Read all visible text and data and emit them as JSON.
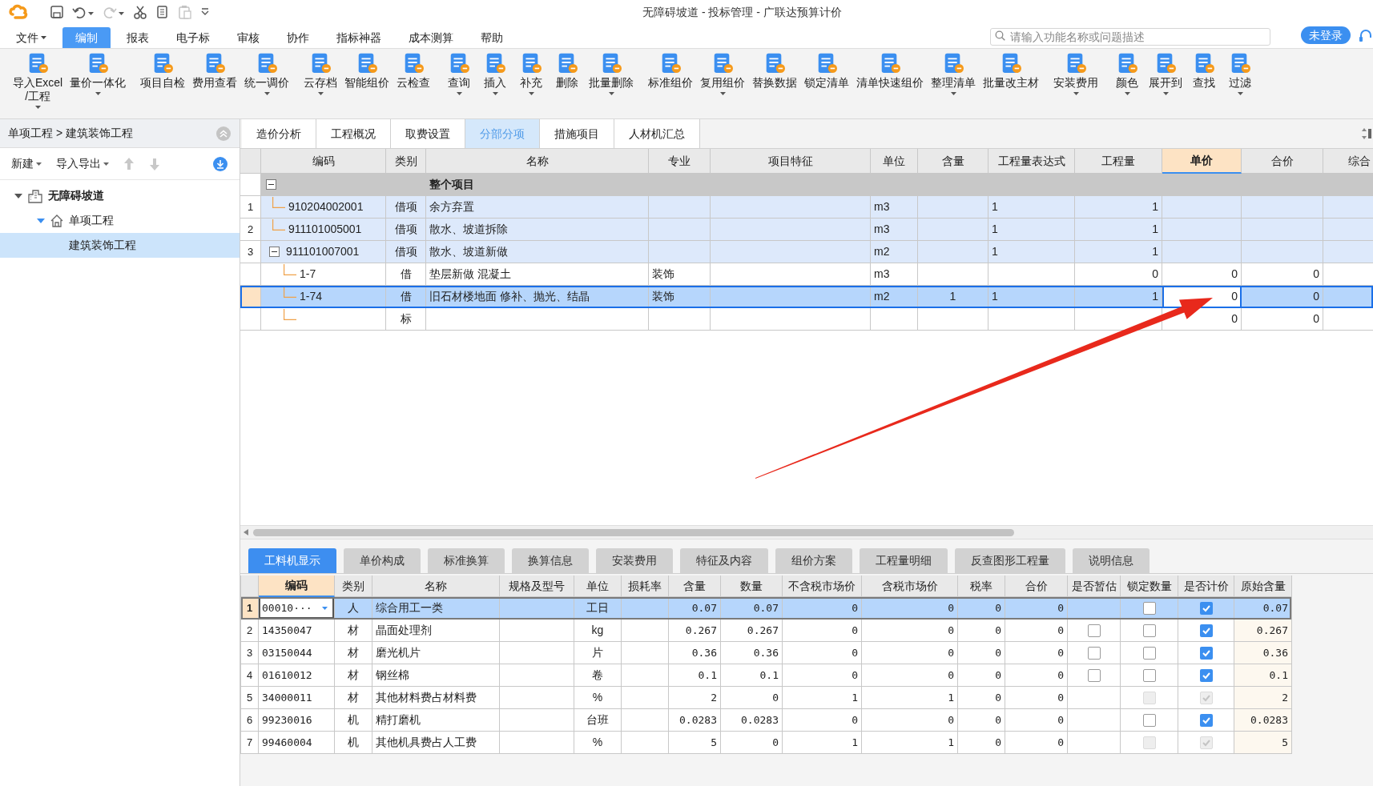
{
  "window": {
    "title": "无障碍坡道 - 投标管理 - 广联达预算计价"
  },
  "quick_access": [
    {
      "kind": "save",
      "disabled": false
    },
    {
      "kind": "undo",
      "disabled": false
    },
    {
      "kind": "redo",
      "disabled": true
    },
    {
      "kind": "cut",
      "disabled": false
    },
    {
      "kind": "copy",
      "disabled": false
    },
    {
      "kind": "paste",
      "disabled": true
    },
    {
      "kind": "customize",
      "disabled": false
    }
  ],
  "menu": [
    {
      "label": "文件",
      "dropdown": true,
      "selected": false
    },
    {
      "label": "编制",
      "dropdown": false,
      "selected": true
    },
    {
      "label": "报表",
      "dropdown": false,
      "selected": false
    },
    {
      "label": "电子标",
      "dropdown": false,
      "selected": false
    },
    {
      "label": "审核",
      "dropdown": false,
      "selected": false
    },
    {
      "label": "协作",
      "dropdown": false,
      "selected": false
    },
    {
      "label": "指标神器",
      "dropdown": false,
      "selected": false
    },
    {
      "label": "成本测算",
      "dropdown": false,
      "selected": false
    },
    {
      "label": "帮助",
      "dropdown": false,
      "selected": false
    }
  ],
  "search": {
    "placeholder": "请输入功能名称或问题描述"
  },
  "login_button": "未登录",
  "ribbon": {
    "groups": [
      [
        {
          "label": "导入Excel\n/工程",
          "dropdown": true
        },
        {
          "label": "量价一体化",
          "dropdown": true
        }
      ],
      [
        {
          "label": "项目自检",
          "dropdown": false
        },
        {
          "label": "费用查看",
          "dropdown": false
        },
        {
          "label": "统一调价",
          "dropdown": true
        }
      ],
      [
        {
          "label": "云存档",
          "dropdown": true
        },
        {
          "label": "智能组价",
          "dropdown": false
        },
        {
          "label": "云检查",
          "dropdown": false
        }
      ],
      [
        {
          "label": "查询",
          "dropdown": true
        },
        {
          "label": "插入",
          "dropdown": true
        },
        {
          "label": "补充",
          "dropdown": true
        },
        {
          "label": "删除",
          "dropdown": false
        },
        {
          "label": "批量删除",
          "dropdown": true
        }
      ],
      [
        {
          "label": "标准组价",
          "dropdown": false
        },
        {
          "label": "复用组价",
          "dropdown": true
        },
        {
          "label": "替换数据",
          "dropdown": false
        },
        {
          "label": "锁定清单",
          "dropdown": false
        },
        {
          "label": "清单快速组价",
          "dropdown": false
        },
        {
          "label": "整理清单",
          "dropdown": true
        },
        {
          "label": "批量改主材",
          "dropdown": false
        }
      ],
      [
        {
          "label": "安装费用",
          "dropdown": true
        }
      ],
      [
        {
          "label": "颜色",
          "dropdown": true
        },
        {
          "label": "展开到",
          "dropdown": true
        },
        {
          "label": "查找",
          "dropdown": false
        },
        {
          "label": "过滤",
          "dropdown": true
        }
      ]
    ]
  },
  "breadcrumb": "单项工程 > 建筑装饰工程",
  "left_toolbar": {
    "buttons": [
      {
        "label": "新建",
        "dropdown": true
      },
      {
        "label": "导入导出",
        "dropdown": true
      }
    ],
    "arrows": [
      {
        "kind": "up",
        "disabled": true
      },
      {
        "kind": "down",
        "disabled": true
      }
    ]
  },
  "project_tree": [
    {
      "label": "无障碍坡道",
      "kind": "project",
      "expanded": true,
      "selected": false,
      "children": [
        {
          "label": "单项工程",
          "kind": "single",
          "expanded": true,
          "selected": false,
          "children": [
            {
              "label": "建筑装饰工程",
              "selected": true
            }
          ]
        }
      ]
    }
  ],
  "tabs": [
    {
      "label": "造价分析",
      "selected": false
    },
    {
      "label": "工程概况",
      "selected": false
    },
    {
      "label": "取费设置",
      "selected": false
    },
    {
      "label": "分部分项",
      "selected": true
    },
    {
      "label": "措施项目",
      "selected": false
    },
    {
      "label": "人材机汇总",
      "selected": false
    }
  ],
  "table": {
    "columns": [
      {
        "label": "编码",
        "selected": false
      },
      {
        "label": "类别",
        "selected": false
      },
      {
        "label": "名称",
        "selected": false
      },
      {
        "label": "专业",
        "selected": false
      },
      {
        "label": "项目特征",
        "selected": false
      },
      {
        "label": "单位",
        "selected": false
      },
      {
        "label": "含量",
        "selected": false
      },
      {
        "label": "工程量表达式",
        "selected": false
      },
      {
        "label": "工程量",
        "selected": false
      },
      {
        "label": "单价",
        "selected": true
      },
      {
        "label": "合价",
        "selected": false
      },
      {
        "label": "综合",
        "selected": false
      }
    ],
    "rows": [
      {
        "kind": "section",
        "name": "整个项目",
        "expanded": true,
        "selected": false,
        "children": [
          {
            "kind": "bill",
            "number": "1",
            "code": "910204002001",
            "category": "借项",
            "name": "余方弃置",
            "unit": "m3",
            "expression": "1",
            "quantity": "1",
            "selected": false
          },
          {
            "kind": "bill",
            "number": "2",
            "code": "911101005001",
            "category": "借项",
            "name": "散水、坡道拆除",
            "unit": "m3",
            "expression": "1",
            "quantity": "1",
            "selected": false
          },
          {
            "kind": "bill",
            "number": "3",
            "code": "911101007001",
            "category": "借项",
            "name": "散水、坡道新做",
            "unit": "m2",
            "expression": "1",
            "quantity": "1",
            "selected": false,
            "expanded": true,
            "children": [
              {
                "kind": "quota",
                "code": "1-7",
                "category": "借",
                "name": "垫层新做 混凝土",
                "specialty": "装饰",
                "unit": "m3",
                "quantity": "0",
                "unit_price": "0",
                "total": "0",
                "selected": false
              },
              {
                "kind": "quota",
                "code": "1-74",
                "category": "借",
                "name": "旧石材楼地面 修补、抛光、结晶",
                "specialty": "装饰",
                "unit": "m2",
                "content": "1",
                "expression": "1",
                "quantity": "1",
                "unit_price": "0",
                "total": "0",
                "selected": true
              },
              {
                "kind": "quota",
                "category": "标",
                "unit_price": "0",
                "total": "0",
                "selected": false
              }
            ]
          }
        ]
      }
    ]
  },
  "bottom_tabs": [
    {
      "label": "工料机显示",
      "selected": true
    },
    {
      "label": "单价构成",
      "selected": false
    },
    {
      "label": "标准换算",
      "selected": false
    },
    {
      "label": "换算信息",
      "selected": false
    },
    {
      "label": "安装费用",
      "selected": false
    },
    {
      "label": "特征及内容",
      "selected": false
    },
    {
      "label": "组价方案",
      "selected": false
    },
    {
      "label": "工程量明细",
      "selected": false
    },
    {
      "label": "反查图形工程量",
      "selected": false
    },
    {
      "label": "说明信息",
      "selected": false
    }
  ],
  "resource_table": {
    "columns": [
      {
        "label": "编码",
        "selected": true
      },
      {
        "label": "类别",
        "selected": false
      },
      {
        "label": "名称",
        "selected": false
      },
      {
        "label": "规格及型号",
        "selected": false
      },
      {
        "label": "单位",
        "selected": false
      },
      {
        "label": "损耗率",
        "selected": false
      },
      {
        "label": "含量",
        "selected": false
      },
      {
        "label": "数量",
        "selected": false
      },
      {
        "label": "不含税市场价",
        "selected": false
      },
      {
        "label": "含税市场价",
        "selected": false
      },
      {
        "label": "税率",
        "selected": false
      },
      {
        "label": "合价",
        "selected": false
      },
      {
        "label": "是否暂估",
        "selected": false
      },
      {
        "label": "锁定数量",
        "selected": false
      },
      {
        "label": "是否计价",
        "selected": false
      },
      {
        "label": "原始含量",
        "selected": false
      }
    ],
    "rows": [
      {
        "number": "1",
        "code": "00010···",
        "category": "人",
        "name": "综合用工一类",
        "unit": "工日",
        "content": "0.07",
        "quantity": "0.07",
        "price_excl_tax": "0",
        "price_incl_tax": "0",
        "tax_rate": "0",
        "total": "0",
        "lock_quantity": {
          "checked": false,
          "disabled": false
        },
        "priced": {
          "checked": true,
          "disabled": false
        },
        "original_content": "0.07",
        "selected": true
      },
      {
        "number": "2",
        "code": "14350047",
        "category": "材",
        "name": "晶面处理剂",
        "unit": "kg",
        "content": "0.267",
        "quantity": "0.267",
        "price_excl_tax": "0",
        "price_incl_tax": "0",
        "tax_rate": "0",
        "total": "0",
        "provisional": {
          "checked": false,
          "disabled": false
        },
        "lock_quantity": {
          "checked": false,
          "disabled": false
        },
        "priced": {
          "checked": true,
          "disabled": false
        },
        "original_content": "0.267",
        "selected": false
      },
      {
        "number": "3",
        "code": "03150044",
        "category": "材",
        "name": "磨光机片",
        "unit": "片",
        "content": "0.36",
        "quantity": "0.36",
        "price_excl_tax": "0",
        "price_incl_tax": "0",
        "tax_rate": "0",
        "total": "0",
        "provisional": {
          "checked": false,
          "disabled": false
        },
        "lock_quantity": {
          "checked": false,
          "disabled": false
        },
        "priced": {
          "checked": true,
          "disabled": false
        },
        "original_content": "0.36",
        "selected": false
      },
      {
        "number": "4",
        "code": "01610012",
        "category": "材",
        "name": "钢丝棉",
        "unit": "卷",
        "content": "0.1",
        "quantity": "0.1",
        "price_excl_tax": "0",
        "price_incl_tax": "0",
        "tax_rate": "0",
        "total": "0",
        "provisional": {
          "checked": false,
          "disabled": false
        },
        "lock_quantity": {
          "checked": false,
          "disabled": false
        },
        "priced": {
          "checked": true,
          "disabled": false
        },
        "original_content": "0.1",
        "selected": false
      },
      {
        "number": "5",
        "code": "34000011",
        "category": "材",
        "name": "其他材料费占材料费",
        "unit": "%",
        "content": "2",
        "quantity": "0",
        "price_excl_tax": "1",
        "price_incl_tax": "1",
        "tax_rate": "0",
        "total": "0",
        "lock_quantity": {
          "checked": false,
          "disabled": true
        },
        "priced": {
          "checked": true,
          "disabled": true
        },
        "original_content": "2",
        "selected": false
      },
      {
        "number": "6",
        "code": "99230016",
        "category": "机",
        "name": "精打磨机",
        "unit": "台班",
        "content": "0.0283",
        "quantity": "0.0283",
        "price_excl_tax": "0",
        "price_incl_tax": "0",
        "tax_rate": "0",
        "total": "0",
        "lock_quantity": {
          "checked": false,
          "disabled": false
        },
        "priced": {
          "checked": true,
          "disabled": false
        },
        "original_content": "0.0283",
        "selected": false
      },
      {
        "number": "7",
        "code": "99460004",
        "category": "机",
        "name": "其他机具费占人工费",
        "unit": "%",
        "content": "5",
        "quantity": "0",
        "price_excl_tax": "1",
        "price_incl_tax": "1",
        "tax_rate": "0",
        "total": "0",
        "lock_quantity": {
          "checked": false,
          "disabled": true
        },
        "priced": {
          "checked": true,
          "disabled": true
        },
        "original_content": "5",
        "selected": false
      }
    ]
  },
  "annotation": {
    "kind": "arrow"
  }
}
